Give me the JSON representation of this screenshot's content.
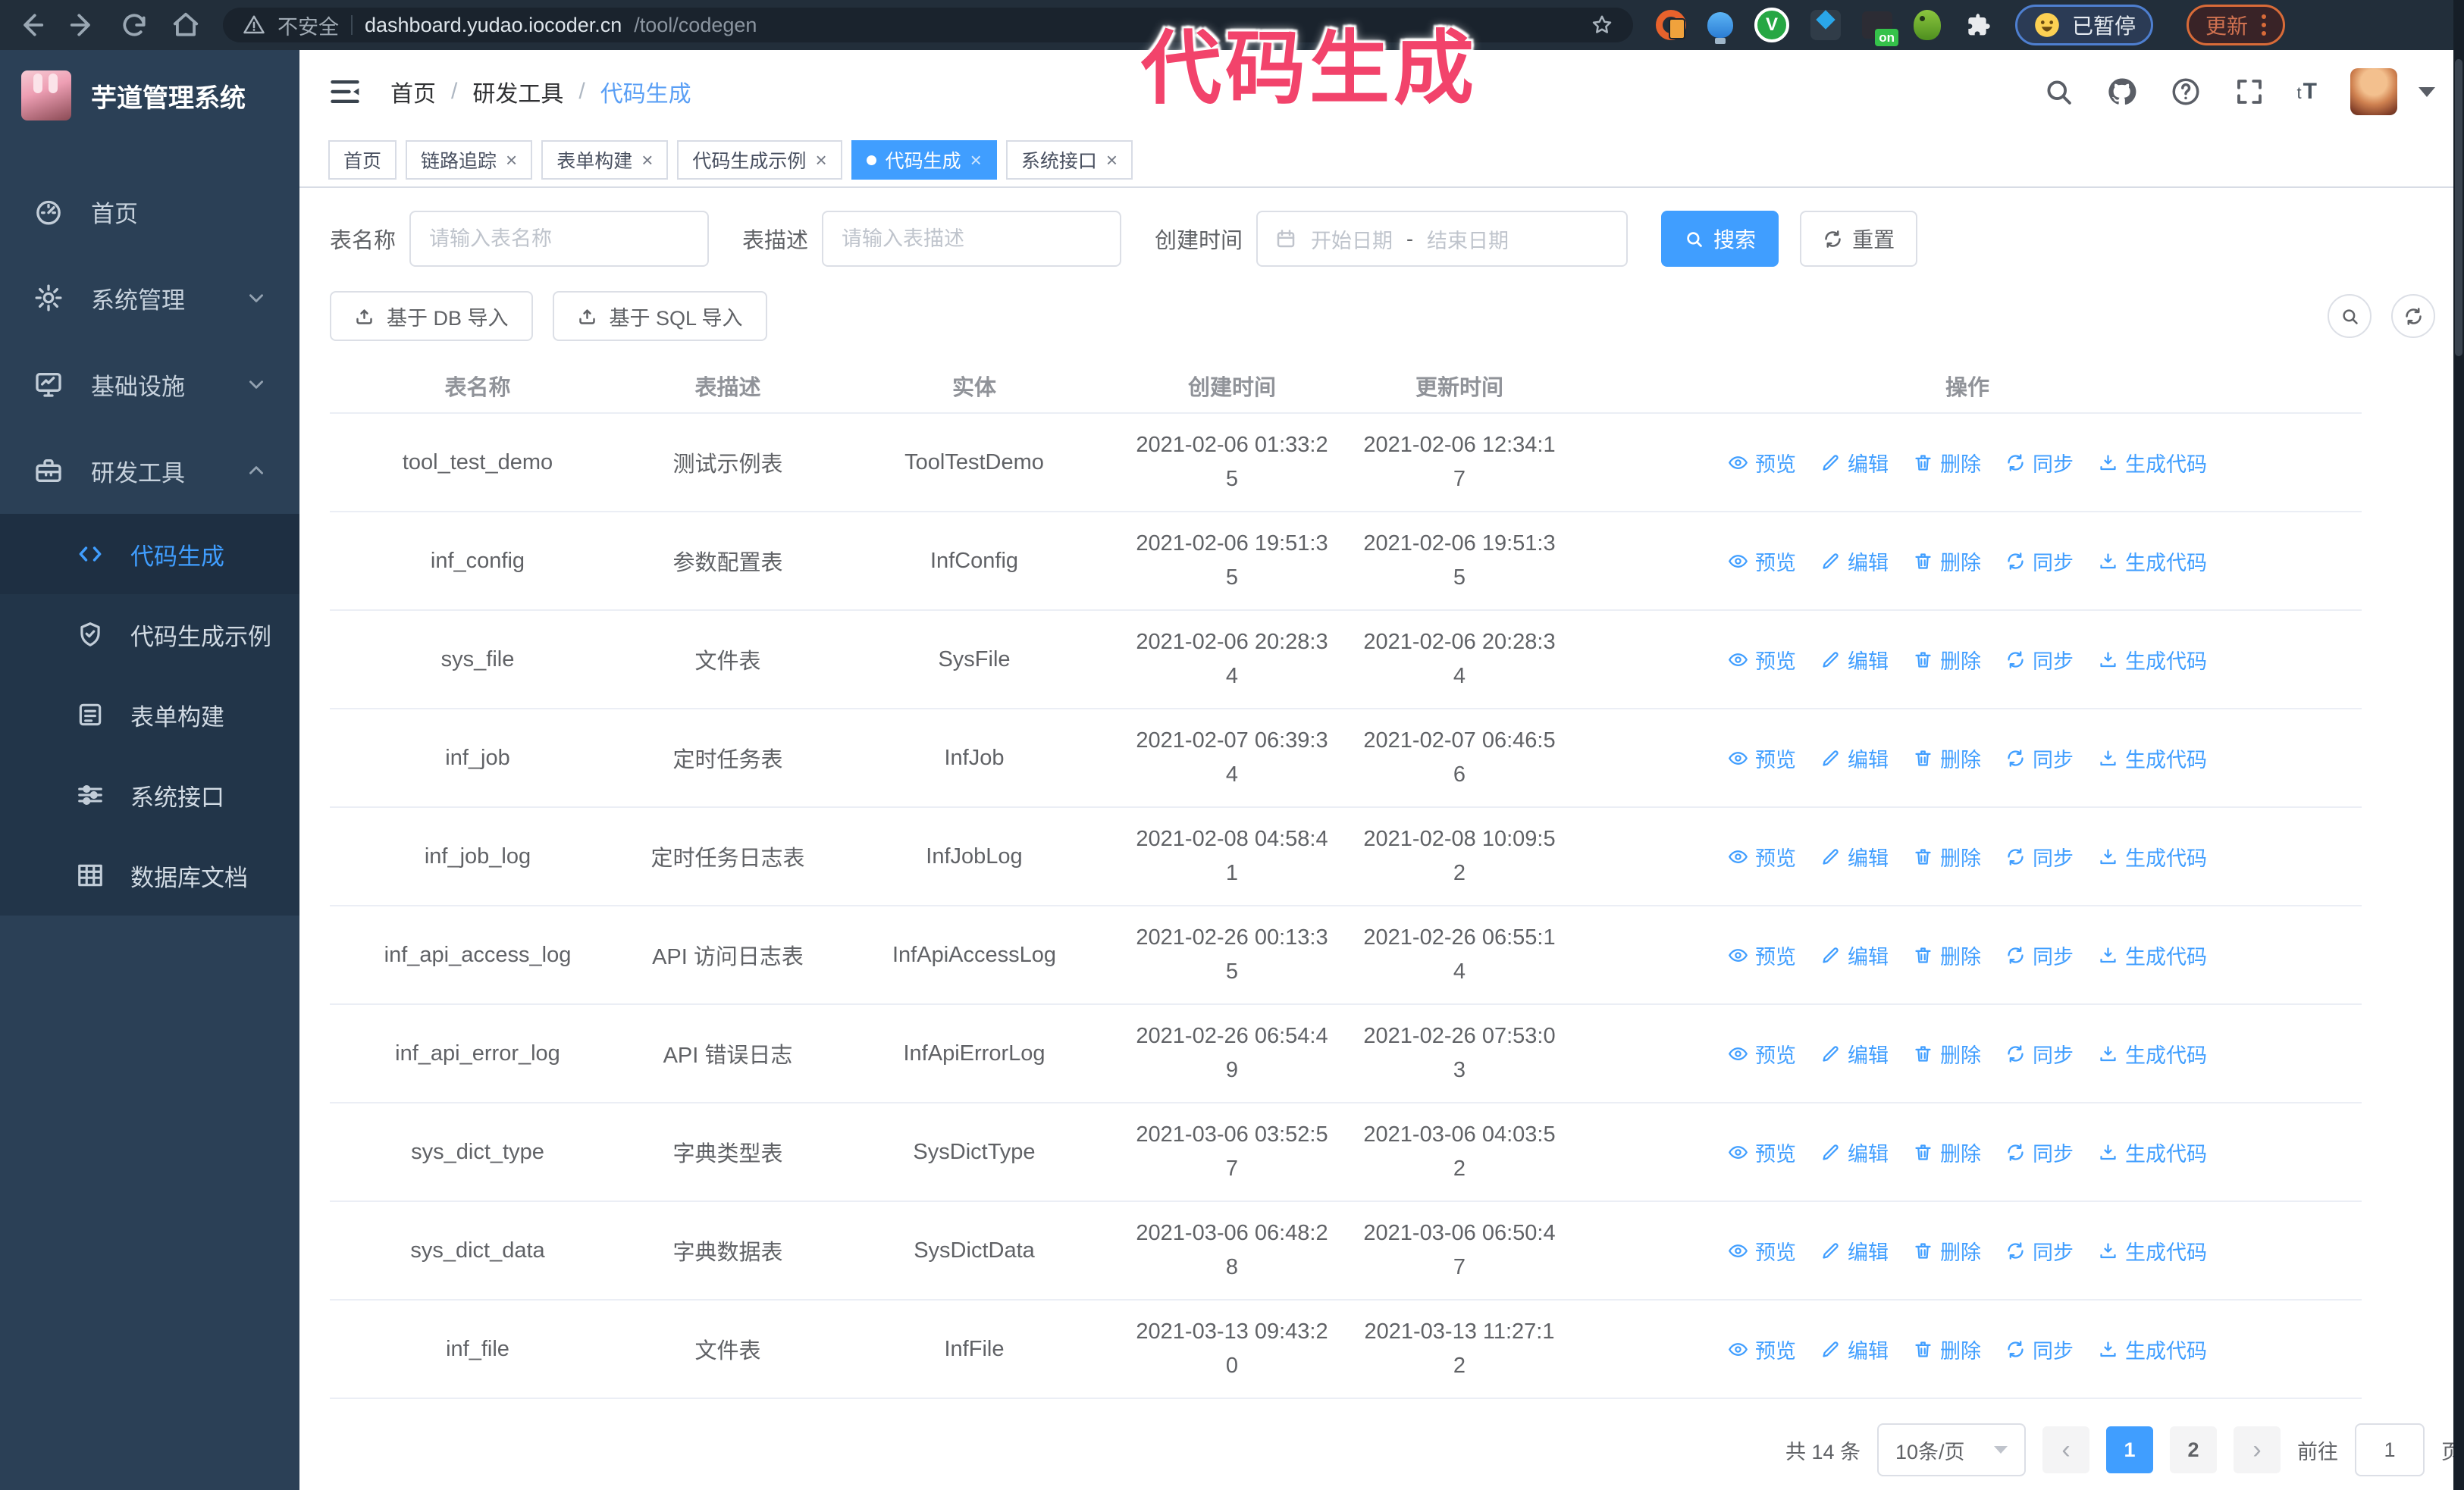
{
  "overlay": {
    "title": "代码生成"
  },
  "browser": {
    "security_label": "不安全",
    "url_host": "dashboard.yudao.iocoder.cn",
    "url_path": "/tool/codegen",
    "ext_v_label": "V",
    "ext_on_badge": "on",
    "paused_badge": "已暂停",
    "update_button": "更新"
  },
  "sidebar": {
    "app_title": "芋道管理系统",
    "items": [
      {
        "label": "首页"
      },
      {
        "label": "系统管理"
      },
      {
        "label": "基础设施"
      },
      {
        "label": "研发工具"
      }
    ],
    "sub_items": [
      {
        "label": "代码生成",
        "active": true
      },
      {
        "label": "代码生成示例"
      },
      {
        "label": "表单构建"
      },
      {
        "label": "系统接口"
      },
      {
        "label": "数据库文档"
      }
    ]
  },
  "breadcrumb": {
    "items": [
      "首页",
      "研发工具",
      "代码生成"
    ],
    "separator": "/"
  },
  "tabs": {
    "items": [
      {
        "label": "首页",
        "closable": false,
        "active": false
      },
      {
        "label": "链路追踪",
        "closable": true,
        "active": false
      },
      {
        "label": "表单构建",
        "closable": true,
        "active": false
      },
      {
        "label": "代码生成示例",
        "closable": true,
        "active": false
      },
      {
        "label": "代码生成",
        "closable": true,
        "active": true
      },
      {
        "label": "系统接口",
        "closable": true,
        "active": false
      }
    ],
    "close_glyph": "×"
  },
  "filters": {
    "table_name_label": "表名称",
    "table_name_placeholder": "请输入表名称",
    "table_desc_label": "表描述",
    "table_desc_placeholder": "请输入表描述",
    "create_time_label": "创建时间",
    "start_placeholder": "开始日期",
    "range_separator": "-",
    "end_placeholder": "结束日期",
    "search_button": "搜索",
    "reset_button": "重置"
  },
  "toolbar": {
    "import_db_button": "基于 DB 导入",
    "import_sql_button": "基于 SQL 导入"
  },
  "table": {
    "columns": [
      "表名称",
      "表描述",
      "实体",
      "创建时间",
      "更新时间",
      "操作"
    ],
    "actions": [
      {
        "name": "preview",
        "label": "预览"
      },
      {
        "name": "edit",
        "label": "编辑"
      },
      {
        "name": "delete",
        "label": "删除"
      },
      {
        "name": "sync",
        "label": "同步"
      },
      {
        "name": "generate",
        "label": "生成代码"
      }
    ],
    "rows": [
      {
        "name": "tool_test_demo",
        "desc": "测试示例表",
        "entity": "ToolTestDemo",
        "created": "2021-02-06 01:33:25",
        "updated": "2021-02-06 12:34:17"
      },
      {
        "name": "inf_config",
        "desc": "参数配置表",
        "entity": "InfConfig",
        "created": "2021-02-06 19:51:35",
        "updated": "2021-02-06 19:51:35"
      },
      {
        "name": "sys_file",
        "desc": "文件表",
        "entity": "SysFile",
        "created": "2021-02-06 20:28:34",
        "updated": "2021-02-06 20:28:34"
      },
      {
        "name": "inf_job",
        "desc": "定时任务表",
        "entity": "InfJob",
        "created": "2021-02-07 06:39:34",
        "updated": "2021-02-07 06:46:56"
      },
      {
        "name": "inf_job_log",
        "desc": "定时任务日志表",
        "entity": "InfJobLog",
        "created": "2021-02-08 04:58:41",
        "updated": "2021-02-08 10:09:52"
      },
      {
        "name": "inf_api_access_log",
        "desc": "API 访问日志表",
        "entity": "InfApiAccessLog",
        "created": "2021-02-26 00:13:35",
        "updated": "2021-02-26 06:55:14"
      },
      {
        "name": "inf_api_error_log",
        "desc": "API 错误日志",
        "entity": "InfApiErrorLog",
        "created": "2021-02-26 06:54:49",
        "updated": "2021-02-26 07:53:03"
      },
      {
        "name": "sys_dict_type",
        "desc": "字典类型表",
        "entity": "SysDictType",
        "created": "2021-03-06 03:52:57",
        "updated": "2021-03-06 04:03:52"
      },
      {
        "name": "sys_dict_data",
        "desc": "字典数据表",
        "entity": "SysDictData",
        "created": "2021-03-06 06:48:28",
        "updated": "2021-03-06 06:50:47"
      },
      {
        "name": "inf_file",
        "desc": "文件表",
        "entity": "InfFile",
        "created": "2021-03-13 09:43:20",
        "updated": "2021-03-13 11:27:12"
      }
    ]
  },
  "pagination": {
    "total_text": "共 14 条",
    "page_size": "10条/页",
    "prev_glyph": "‹",
    "next_glyph": "›",
    "pages": [
      "1",
      "2"
    ],
    "active_page": "1",
    "goto_label": "前往",
    "goto_value": "1",
    "page_suffix": "页"
  },
  "colors": {
    "accent": "#409eff",
    "sidebar_bg": "#2b4056",
    "submenu_bg": "#223549",
    "browser_bar_bg": "#222e3a",
    "overlay_pink": "#f2436b",
    "update_orange": "#d96b38",
    "paused_blue": "#4e7fd0"
  }
}
